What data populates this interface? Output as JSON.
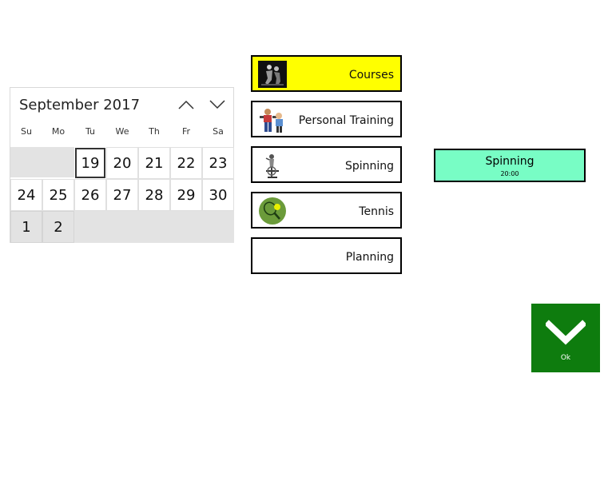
{
  "calendar": {
    "title": "September 2017",
    "weekdays": [
      "Su",
      "Mo",
      "Tu",
      "We",
      "Th",
      "Fr",
      "Sa"
    ],
    "today": "19",
    "days": {
      "d19": "19",
      "d20": "20",
      "d21": "21",
      "d22": "22",
      "d23": "23",
      "d24": "24",
      "d25": "25",
      "d26": "26",
      "d27": "27",
      "d28": "28",
      "d29": "29",
      "d30": "30",
      "n1": "1",
      "n2": "2"
    }
  },
  "menu": {
    "courses": "Courses",
    "personal_training": "Personal Training",
    "spinning": "Spinning",
    "tennis": "Tennis",
    "planning": "Planning",
    "selected_color": "#ffff00"
  },
  "event": {
    "title": "Spinning",
    "time": "20:00",
    "color": "#78fdc5"
  },
  "ok": {
    "label": "Ok",
    "color": "#0e7c0e"
  }
}
